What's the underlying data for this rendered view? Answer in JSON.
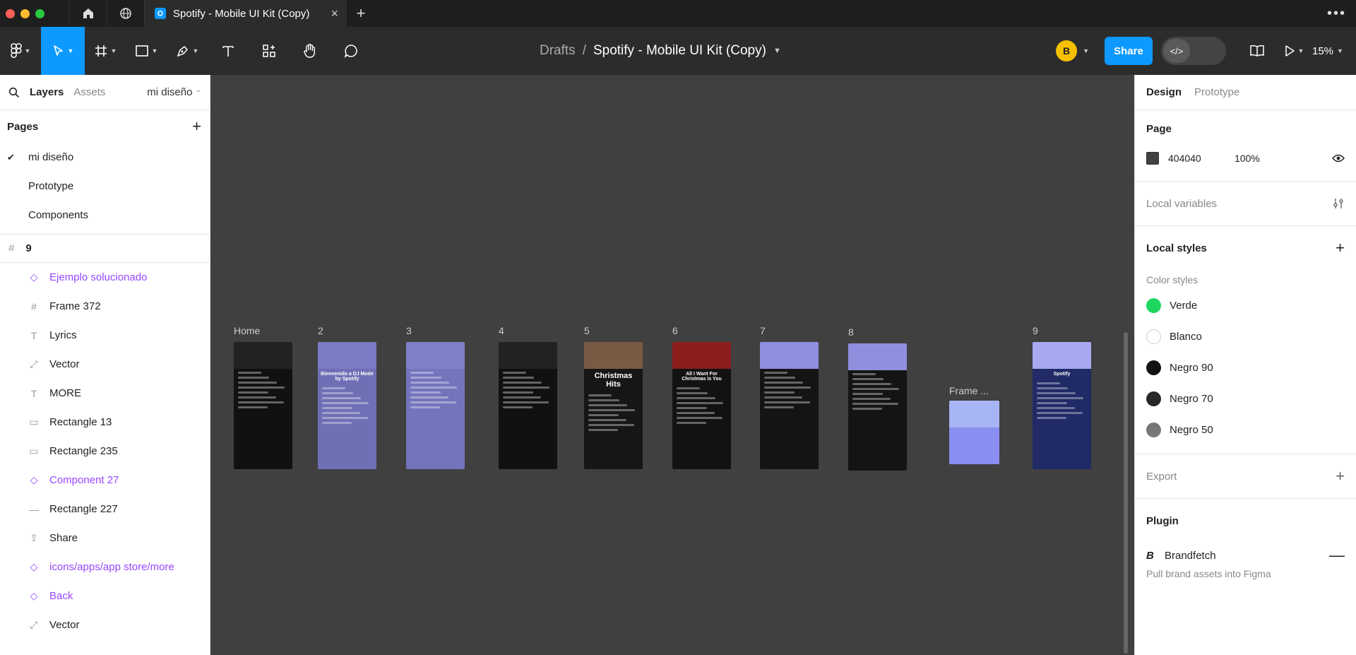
{
  "titlebar": {
    "tab_title": "Spotify - Mobile UI Kit (Copy)"
  },
  "toolbar": {
    "breadcrumb_root": "Drafts",
    "breadcrumb_sep": "/",
    "file_name": "Spotify - Mobile UI Kit (Copy)",
    "avatar_initial": "B",
    "share_label": "Share",
    "zoom": "15%"
  },
  "left_panel": {
    "tab_layers": "Layers",
    "tab_assets": "Assets",
    "current_page": "mi diseño",
    "pages_heading": "Pages",
    "pages": [
      "mi diseño",
      "Prototype",
      "Components"
    ],
    "frame_name": "9",
    "layers": [
      {
        "name": "Ejemplo solucionado",
        "icon": "component-icon",
        "component": true
      },
      {
        "name": "Frame 372",
        "icon": "frame-icon",
        "component": false
      },
      {
        "name": "Lyrics",
        "icon": "text-icon",
        "component": false
      },
      {
        "name": "Vector",
        "icon": "vector-icon",
        "component": false
      },
      {
        "name": "MORE",
        "icon": "text-icon",
        "component": false
      },
      {
        "name": "Rectangle 13",
        "icon": "rectangle-icon",
        "component": false
      },
      {
        "name": "Rectangle 235",
        "icon": "rectangle-icon",
        "component": false
      },
      {
        "name": "Component 27",
        "icon": "component-icon",
        "component": true
      },
      {
        "name": "Rectangle 227",
        "icon": "line-icon",
        "component": false
      },
      {
        "name": "Share",
        "icon": "share-icon",
        "component": false
      },
      {
        "name": "icons/apps/app store/more",
        "icon": "component-icon",
        "component": true
      },
      {
        "name": "Back",
        "icon": "component-icon",
        "component": true
      },
      {
        "name": "Vector",
        "icon": "vector-icon",
        "component": false
      }
    ]
  },
  "right_panel": {
    "tab_design": "Design",
    "tab_prototype": "Prototype",
    "page_heading": "Page",
    "page_color": "404040",
    "page_opacity": "100%",
    "local_variables": "Local variables",
    "local_styles": "Local styles",
    "color_styles_label": "Color styles",
    "color_styles": [
      {
        "name": "Verde",
        "color": "#1ed760"
      },
      {
        "name": "Blanco",
        "color": "#ffffff"
      },
      {
        "name": "Negro 90",
        "color": "#121212"
      },
      {
        "name": "Negro 70",
        "color": "#282828"
      },
      {
        "name": "Negro 50",
        "color": "#777777"
      }
    ],
    "export_label": "Export",
    "plugin_heading": "Plugin",
    "plugin_name": "Brandfetch",
    "plugin_desc": "Pull brand assets into Figma"
  },
  "canvas": {
    "frames": [
      "Home",
      "2",
      "3",
      "4",
      "5",
      "6",
      "7",
      "8",
      "Frame ...",
      "9"
    ],
    "frame_texts": {
      "dj_mode": "Bienvenido a DJ Mode by Spotify",
      "christmas": "Christmas Hits",
      "all_i_want": "All I Want For Christmas Is You",
      "spotify": "Spotify"
    }
  },
  "colors": {
    "accent": "#0d99ff",
    "canvas_bg": "#404040",
    "component_purple": "#9747ff"
  }
}
